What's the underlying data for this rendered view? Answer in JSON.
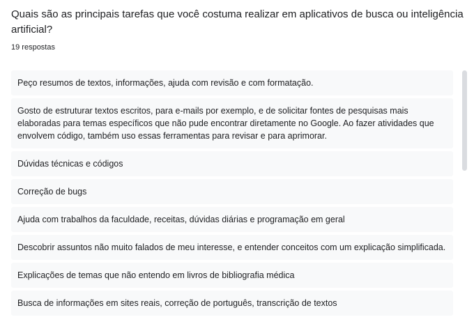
{
  "question": {
    "title": "Quais são as principais tarefas que você costuma realizar em aplicativos de busca ou inteligência artificial?",
    "response_count": "19 respostas"
  },
  "responses": [
    "Peço resumos de textos, informações, ajuda com revisão e com formatação.",
    "Gosto de estruturar textos escritos, para e-mails por exemplo, e de solicitar fontes de pesquisas mais elaboradas para temas específicos que não pude encontrar diretamente no Google. Ao fazer atividades que envolvem código, também uso essas ferramentas para revisar e para aprimorar.",
    "Dúvidas técnicas e códigos",
    "Correção de bugs",
    "Ajuda com trabalhos da faculdade, receitas, dúvidas diárias e programação em geral",
    "Descobrir assuntos não muito falados de meu interesse, e entender conceitos com um explicação simplificada.",
    "Explicações de temas que não entendo em livros de bibliografia médica",
    "Busca de informações em sites reais, correção de português, transcrição de textos"
  ],
  "colors": {
    "item_background": "#f8f9fa",
    "text": "#202124",
    "scrollbar": "#dadce0"
  }
}
